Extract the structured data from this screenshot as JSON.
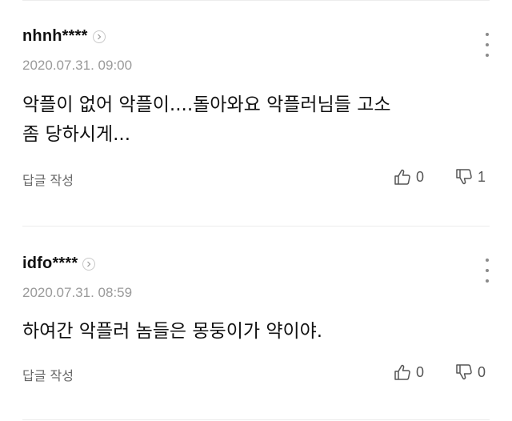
{
  "comments": [
    {
      "author": "nhnh****",
      "timestamp": "2020.07.31. 09:00",
      "body_lines": [
        "악플이 없어 악플이....돌아와요 악플러님들 고소",
        "좀 당하시게..."
      ],
      "reply_label": "답글 작성",
      "like_count": "0",
      "dislike_count": "1"
    },
    {
      "author": "idfo****",
      "timestamp": "2020.07.31. 08:59",
      "body_lines": [
        "하여간 악플러 놈들은 몽둥이가 약이야."
      ],
      "reply_label": "답글 작성",
      "like_count": "0",
      "dislike_count": "0"
    }
  ],
  "icons": {
    "profile": "chevron-right-circle-icon",
    "more": "vertical-ellipsis-icon",
    "like": "thumbs-up-icon",
    "dislike": "thumbs-down-icon"
  },
  "colors": {
    "author": "#111111",
    "timestamp": "#9a9a9a",
    "body": "#111111",
    "meta": "#666666",
    "divider": "#ececec"
  }
}
